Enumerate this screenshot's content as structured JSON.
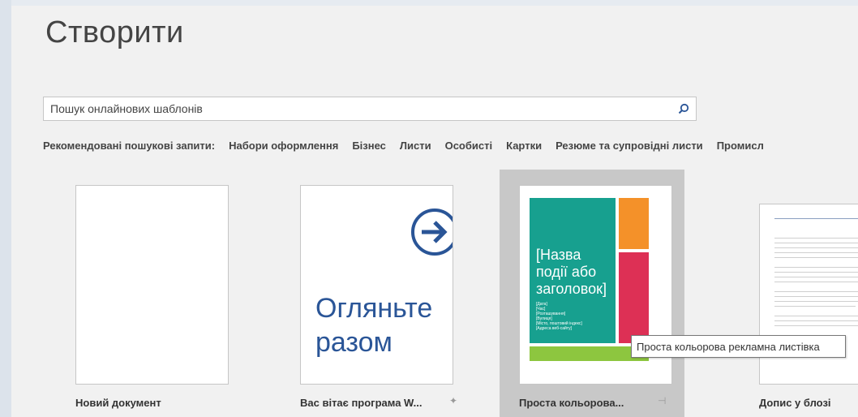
{
  "header": {
    "title": "Створити"
  },
  "search": {
    "placeholder": "Пошук онлайнових шаблонів",
    "button_icon": "search-icon"
  },
  "suggested": {
    "label": "Рекомендовані пошукові запити:",
    "items": [
      "Набори оформлення",
      "Бізнес",
      "Листи",
      "Особисті",
      "Картки",
      "Резюме та супровідні листи",
      "Промисл"
    ]
  },
  "templates": [
    {
      "label": "Новий документ"
    },
    {
      "label": "Вас вітає програма W...",
      "thumb_text": [
        "Огляньте",
        "разом"
      ],
      "pin_icon": "pin-icon"
    },
    {
      "label": "Проста кольорова...",
      "thumb_title": [
        "[Назва",
        "події або",
        "заголовок]"
      ],
      "thumb_small": [
        "[Дата]",
        "[Час]",
        "[Розташування]",
        "[Вулиця]",
        "[Місто, поштовий індекс]",
        "[Адреса веб-сайту]"
      ],
      "pin_icon": "pin-icon"
    },
    {
      "label": "Допис у блозі"
    }
  ],
  "tooltip": {
    "text": "Проста кольорова рекламна листівка"
  },
  "colors": {
    "accent_blue": "#2a5597",
    "flyer_teal": "#17a08f",
    "flyer_orange": "#f49129",
    "flyer_pink": "#dd3055",
    "flyer_lime": "#8dc63f"
  }
}
